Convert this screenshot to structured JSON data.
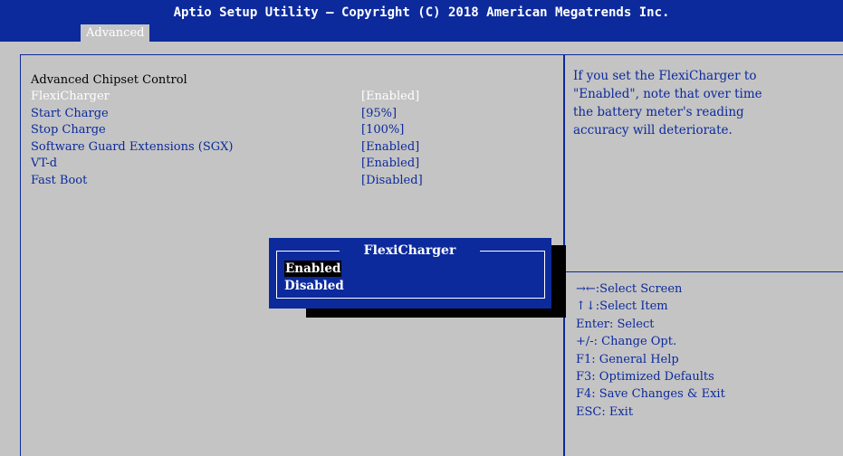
{
  "header": {
    "title": "Aptio Setup Utility – Copyright (C) 2018 American Megatrends Inc.",
    "tab": "Advanced"
  },
  "colors": {
    "background": "#c4c4c4",
    "accent_blue": "#0c2a9c",
    "text_white": "#ffffff",
    "text_black": "#000000"
  },
  "settings": {
    "section_title": "Advanced Chipset Control",
    "items": [
      {
        "label": "FlexiCharger",
        "value": "[Enabled]"
      },
      {
        "label": "Start Charge",
        "value": "[95%]"
      },
      {
        "label": "Stop Charge",
        "value": "[100%]"
      },
      {
        "label": "Software Guard Extensions (SGX)",
        "value": "[Enabled]"
      },
      {
        "label": "VT-d",
        "value": "[Enabled]"
      },
      {
        "label": "Fast Boot",
        "value": "[Disabled]"
      }
    ]
  },
  "help": {
    "lines": [
      "If you set the FlexiCharger to",
      "\"Enabled\", note that over time",
      "the battery meter's reading",
      "accuracy will deteriorate."
    ]
  },
  "key_help": [
    "→←:Select Screen",
    "↑↓:Select Item",
    "Enter: Select",
    "+/-: Change Opt.",
    "F1: General Help",
    "F3: Optimized Defaults",
    "F4: Save Changes & Exit",
    "ESC: Exit"
  ],
  "popup": {
    "title": "FlexiCharger",
    "options": [
      "Enabled",
      "Disabled"
    ],
    "selected": "Enabled"
  }
}
